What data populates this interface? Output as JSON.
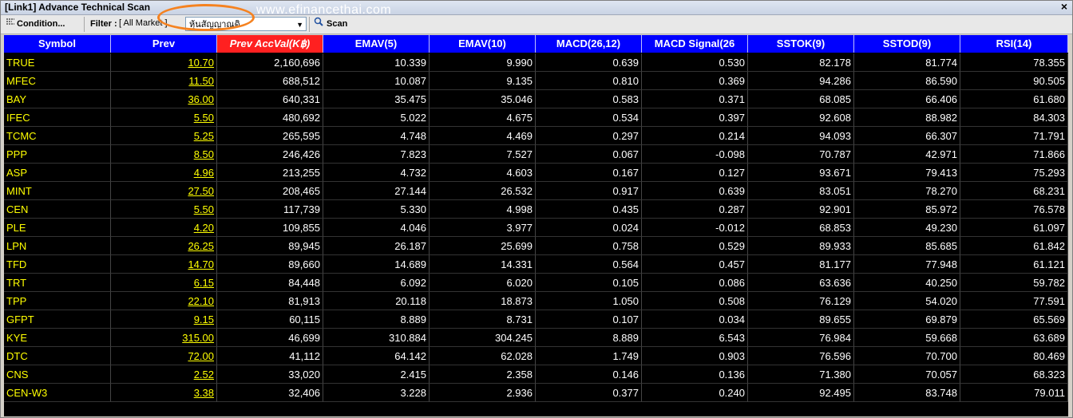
{
  "window": {
    "title": "[Link1] Advance Technical Scan",
    "close": "×"
  },
  "watermark": "www.efinancethai.com",
  "toolbar": {
    "condition_label": "Condition...",
    "filter_label": "Filter :",
    "filter_value": "[ All Market ]",
    "combo_value": "หุ้นสัญญาณดิ",
    "scan_label": "Scan"
  },
  "columns": [
    "Symbol",
    "Prev",
    "Prev AccVal(K฿)",
    "EMAV(5)",
    "EMAV(10)",
    "MACD(26,12)",
    "MACD Signal(26",
    "SSTOK(9)",
    "SSTOD(9)",
    "RSI(14)"
  ],
  "rows": [
    [
      "TRUE",
      "10.70",
      "2,160,696",
      "10.339",
      "9.990",
      "0.639",
      "0.530",
      "82.178",
      "81.774",
      "78.355"
    ],
    [
      "MFEC",
      "11.50",
      "688,512",
      "10.087",
      "9.135",
      "0.810",
      "0.369",
      "94.286",
      "86.590",
      "90.505"
    ],
    [
      "BAY",
      "36.00",
      "640,331",
      "35.475",
      "35.046",
      "0.583",
      "0.371",
      "68.085",
      "66.406",
      "61.680"
    ],
    [
      "IFEC",
      "5.50",
      "480,692",
      "5.022",
      "4.675",
      "0.534",
      "0.397",
      "92.608",
      "88.982",
      "84.303"
    ],
    [
      "TCMC",
      "5.25",
      "265,595",
      "4.748",
      "4.469",
      "0.297",
      "0.214",
      "94.093",
      "66.307",
      "71.791"
    ],
    [
      "PPP",
      "8.50",
      "246,426",
      "7.823",
      "7.527",
      "0.067",
      "-0.098",
      "70.787",
      "42.971",
      "71.866"
    ],
    [
      "ASP",
      "4.96",
      "213,255",
      "4.732",
      "4.603",
      "0.167",
      "0.127",
      "93.671",
      "79.413",
      "75.293"
    ],
    [
      "MINT",
      "27.50",
      "208,465",
      "27.144",
      "26.532",
      "0.917",
      "0.639",
      "83.051",
      "78.270",
      "68.231"
    ],
    [
      "CEN",
      "5.50",
      "117,739",
      "5.330",
      "4.998",
      "0.435",
      "0.287",
      "92.901",
      "85.972",
      "76.578"
    ],
    [
      "PLE",
      "4.20",
      "109,855",
      "4.046",
      "3.977",
      "0.024",
      "-0.012",
      "68.853",
      "49.230",
      "61.097"
    ],
    [
      "LPN",
      "26.25",
      "89,945",
      "26.187",
      "25.699",
      "0.758",
      "0.529",
      "89.933",
      "85.685",
      "61.842"
    ],
    [
      "TFD",
      "14.70",
      "89,660",
      "14.689",
      "14.331",
      "0.564",
      "0.457",
      "81.177",
      "77.948",
      "61.121"
    ],
    [
      "TRT",
      "6.15",
      "84,448",
      "6.092",
      "6.020",
      "0.105",
      "0.086",
      "63.636",
      "40.250",
      "59.782"
    ],
    [
      "TPP",
      "22.10",
      "81,913",
      "20.118",
      "18.873",
      "1.050",
      "0.508",
      "76.129",
      "54.020",
      "77.591"
    ],
    [
      "GFPT",
      "9.15",
      "60,115",
      "8.889",
      "8.731",
      "0.107",
      "0.034",
      "89.655",
      "69.879",
      "65.569"
    ],
    [
      "KYE",
      "315.00",
      "46,699",
      "310.884",
      "304.245",
      "8.889",
      "6.543",
      "76.984",
      "59.668",
      "63.689"
    ],
    [
      "DTC",
      "72.00",
      "41,112",
      "64.142",
      "62.028",
      "1.749",
      "0.903",
      "76.596",
      "70.700",
      "80.469"
    ],
    [
      "CNS",
      "2.52",
      "33,020",
      "2.415",
      "2.358",
      "0.146",
      "0.136",
      "71.380",
      "70.057",
      "68.323"
    ],
    [
      "CEN-W3",
      "3.38",
      "32,406",
      "3.228",
      "2.936",
      "0.377",
      "0.240",
      "92.495",
      "83.748",
      "79.011"
    ]
  ],
  "colors": {
    "header": "#0000ff",
    "active_header": "#ff2020",
    "symbol": "#ffff00",
    "grid_bg": "#000000"
  }
}
